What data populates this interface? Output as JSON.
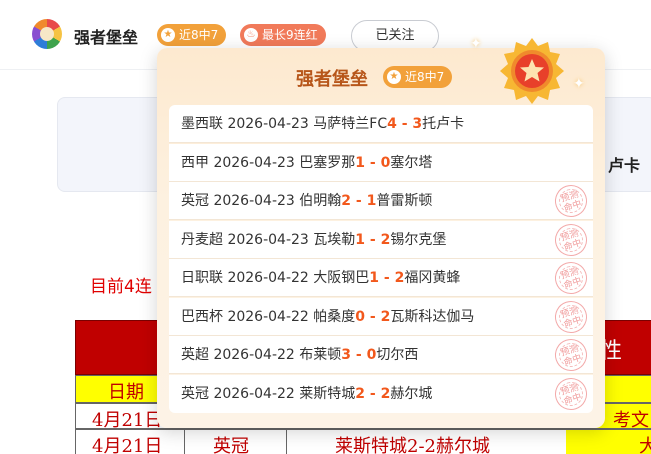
{
  "header": {
    "author_name": "强者堡垒",
    "streak_badge": "近8中7",
    "best_badge": "最长9连红",
    "follow_button": "已关注"
  },
  "background": {
    "card_text": "卢卡",
    "streak_text": "目前4连",
    "red_header_text": "性",
    "yellow_header_text": "日期",
    "rows": [
      {
        "date": "4月21日",
        "right": "考文"
      },
      {
        "date": "4月21日",
        "league": "英冠",
        "match": "莱斯特城2-2赫尔城",
        "right": "大"
      }
    ]
  },
  "popup": {
    "title": "强者堡垒",
    "badge": "近8中7",
    "stamp_text": "预测命中",
    "matches": [
      {
        "league": "墨西联",
        "date": "2026-04-23",
        "home": "马萨特兰FC",
        "home_score": "4",
        "sep": " - ",
        "away_score": "3",
        "away": "托卢卡",
        "hit": false
      },
      {
        "league": "西甲",
        "date": "2026-04-23",
        "home": "巴塞罗那",
        "home_score": "1",
        "sep": " - ",
        "away_score": "0",
        "away": "塞尔塔",
        "hit": false
      },
      {
        "league": "英冠",
        "date": "2026-04-23",
        "home": "伯明翰",
        "home_score": "2",
        "sep": " - ",
        "away_score": "1",
        "away": "普雷斯顿",
        "hit": true
      },
      {
        "league": "丹麦超",
        "date": "2026-04-23",
        "home": "瓦埃勒",
        "home_score": "1",
        "sep": " - ",
        "away_score": "2",
        "away": "锡尔克堡",
        "hit": true
      },
      {
        "league": "日职联",
        "date": "2026-04-22",
        "home": "大阪钢巴",
        "home_score": "1",
        "sep": " - ",
        "away_score": "2",
        "away": "福冈黄蜂",
        "hit": true
      },
      {
        "league": "巴西杯",
        "date": "2026-04-22",
        "home": "帕桑度",
        "home_score": "0",
        "sep": " - ",
        "away_score": "2",
        "away": "瓦斯科达伽马",
        "hit": true
      },
      {
        "league": "英超",
        "date": "2026-04-22",
        "home": "布莱顿",
        "home_score": "3",
        "sep": " - ",
        "away_score": "0",
        "away": "切尔西",
        "hit": true
      },
      {
        "league": "英冠",
        "date": "2026-04-22",
        "home": "莱斯特城",
        "home_score": "2",
        "sep": " - ",
        "away_score": "2",
        "away": "赫尔城",
        "hit": true
      }
    ]
  }
}
